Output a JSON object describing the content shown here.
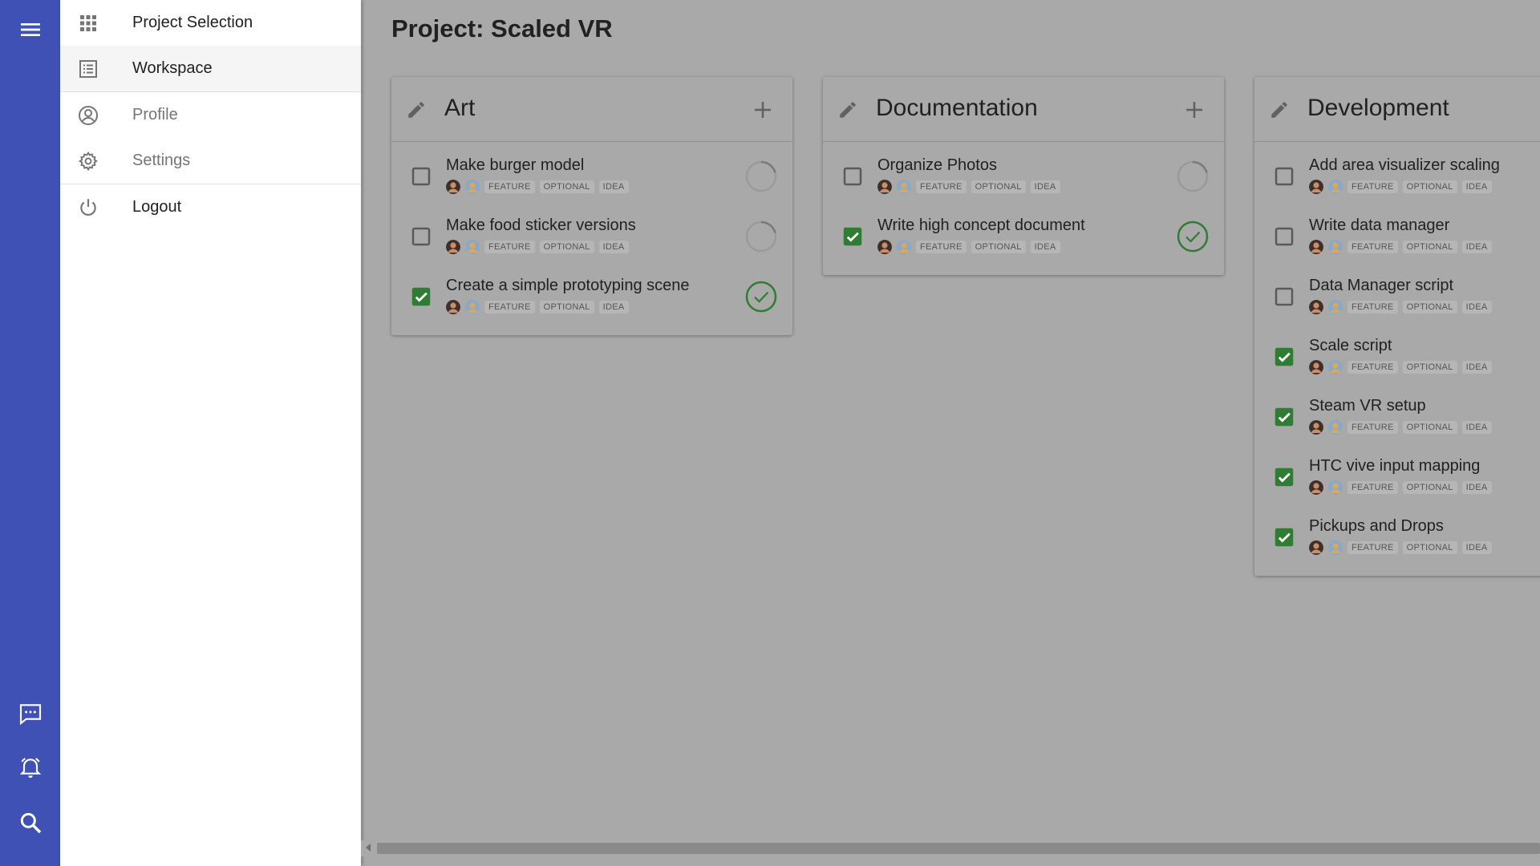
{
  "rail": {
    "icons": [
      "menu-icon",
      "chat-icon",
      "alarm-bell-icon",
      "search-icon"
    ]
  },
  "drawer": {
    "items": [
      {
        "label": "Project Selection",
        "icon": "grid-icon"
      },
      {
        "label": "Workspace",
        "icon": "list-icon"
      },
      {
        "label": "Profile",
        "icon": "account-circle-icon"
      },
      {
        "label": "Settings",
        "icon": "gear-icon"
      },
      {
        "label": "Logout",
        "icon": "power-icon"
      }
    ]
  },
  "project": {
    "title": "Project: Scaled VR"
  },
  "colors": {
    "rail": "#3f51b5",
    "check": "#2e7d32",
    "background": "#a9a9a9"
  },
  "columns": [
    {
      "title": "Art",
      "tasks": [
        {
          "name": "Make burger model",
          "tags": [
            "FEATURE",
            "OPTIONAL",
            "IDEA"
          ],
          "done": false,
          "status": "in-progress"
        },
        {
          "name": "Make food sticker versions",
          "tags": [
            "FEATURE",
            "OPTIONAL",
            "IDEA"
          ],
          "done": false,
          "status": "in-progress"
        },
        {
          "name": "Create a simple prototyping scene",
          "tags": [
            "FEATURE",
            "OPTIONAL",
            "IDEA"
          ],
          "done": true,
          "status": "complete"
        }
      ]
    },
    {
      "title": "Documentation",
      "tasks": [
        {
          "name": "Organize Photos",
          "tags": [
            "FEATURE",
            "OPTIONAL",
            "IDEA"
          ],
          "done": false,
          "status": "in-progress"
        },
        {
          "name": "Write high concept document",
          "tags": [
            "FEATURE",
            "OPTIONAL",
            "IDEA"
          ],
          "done": true,
          "status": "complete"
        }
      ]
    },
    {
      "title": "Development",
      "tasks": [
        {
          "name": "Add area visualizer scaling",
          "tags": [
            "FEATURE",
            "OPTIONAL",
            "IDEA"
          ],
          "done": false
        },
        {
          "name": "Write data manager",
          "tags": [
            "FEATURE",
            "OPTIONAL",
            "IDEA"
          ],
          "done": false
        },
        {
          "name": "Data Manager script",
          "tags": [
            "FEATURE",
            "OPTIONAL",
            "IDEA"
          ],
          "done": false
        },
        {
          "name": "Scale script",
          "tags": [
            "FEATURE",
            "OPTIONAL",
            "IDEA"
          ],
          "done": true
        },
        {
          "name": "Steam VR setup",
          "tags": [
            "FEATURE",
            "OPTIONAL",
            "IDEA"
          ],
          "done": true
        },
        {
          "name": "HTC vive input mapping",
          "tags": [
            "FEATURE",
            "OPTIONAL",
            "IDEA"
          ],
          "done": true
        },
        {
          "name": "Pickups and Drops",
          "tags": [
            "FEATURE",
            "OPTIONAL",
            "IDEA"
          ],
          "done": true
        }
      ]
    }
  ]
}
